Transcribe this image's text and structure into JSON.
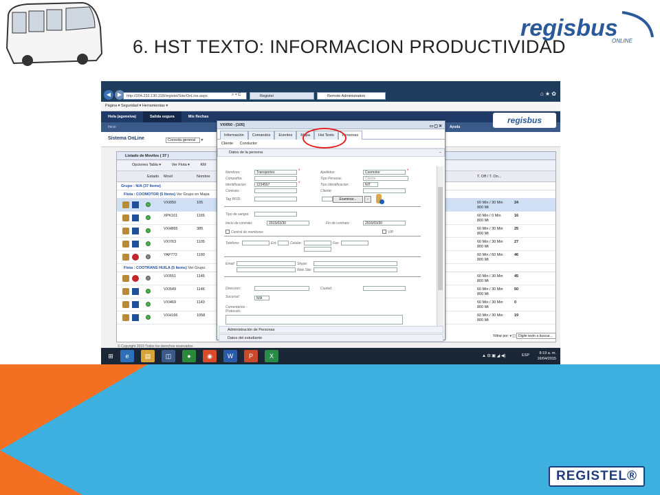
{
  "slide": {
    "title": "6. HST TEXTO: INFORMACION PRODUCTIVIDAD",
    "brand_top": "regisbus",
    "brand_top_sub": "ONLINE",
    "brand_bottom": "REGISTEL®"
  },
  "browser": {
    "address": "http://204.232.130.228/registel/Site/OnLine.aspx",
    "address_controls": "⌕ ▾ C",
    "tabs": [
      "Registel",
      "Remote Administration"
    ],
    "command_bar": "Página ▾  Seguridad ▾  Herramientas ▾",
    "window_icons": "⌂ ★ ✿"
  },
  "app": {
    "nav": [
      "Hola (agoneiva)",
      "Salida segura",
      "Mis flechas"
    ],
    "subnav": "Inicio",
    "help": "Ayuda",
    "logo": "regisbus",
    "system_name": "Sistema OnLine",
    "console_label": "Consola general"
  },
  "list": {
    "title": "Listado de Moviles ( 37 )",
    "toolbar": [
      "Opciones Tabla ▾",
      "Ver Flota ▾",
      "KM"
    ],
    "columns": [
      "Estado",
      "Movil",
      "Nombre",
      "T. Off / T. On..."
    ],
    "group_header": "Grupo : N/A (37 Items)",
    "fleets": [
      {
        "label": "Flota : COOMOTOR (5 Items)",
        "link": "Ver Grupo en Mapa",
        "rows": [
          {
            "movil": "VXI050",
            "nombre": "105",
            "t": "60 Min / 30 Min",
            "t2": "800 Mt",
            "v": "24",
            "status": "green",
            "sel": true
          },
          {
            "movil": "XPK161",
            "nombre": "1165",
            "t": "60 Min / 0 Min",
            "t2": "800 Mt",
            "v": "16",
            "status": "green"
          },
          {
            "movil": "VXH865",
            "nombre": "385",
            "t": "60 Min / 30 Min",
            "t2": "800 Mt",
            "v": "25",
            "status": "green"
          },
          {
            "movil": "VXI763",
            "nombre": "1105",
            "t": "60 Min / 30 Min",
            "t2": "800 Mt",
            "v": "27",
            "status": "green"
          },
          {
            "movil": "YAP772",
            "nombre": "1190",
            "t": "60 Min / 60 Min",
            "t2": "800 Mt",
            "v": "46",
            "status": "gray"
          }
        ]
      },
      {
        "label": "Flota : COOTRANS HUILA (5 Items)",
        "link": "Ver Grupo",
        "rows": [
          {
            "movil": "VXI551",
            "nombre": "1145",
            "t": "60 Min / 30 Min",
            "t2": "800 Mt",
            "v": "45",
            "status": "gray"
          },
          {
            "movil": "VXI549",
            "nombre": "1146",
            "t": "60 Min / 30 Min",
            "t2": "800 Mt",
            "v": "50",
            "status": "green"
          },
          {
            "movil": "VXI469",
            "nombre": "1143",
            "t": "60 Min / 30 Min",
            "t2": "800 Mt",
            "v": "0",
            "status": "green"
          },
          {
            "movil": "VXH166",
            "nombre": "1058",
            "t": "60 Min / 30 Min",
            "t2": "800 Mt",
            "v": "19",
            "status": "green"
          }
        ]
      }
    ],
    "footer": "© Copyright 2015 Todos los derechos reservados",
    "filter_label": "Filtrar por: ▾",
    "filter_brackets": "[ ]",
    "filter_placeholder": "Digite texto a buscar..."
  },
  "modal": {
    "title": "VXI050 - [105]",
    "tabs": [
      "Información",
      "Comandos",
      "Eventos",
      "Mapa",
      "Hst Texto",
      "Personas"
    ],
    "subtabs": [
      "Cliente",
      "Conductor"
    ],
    "section": "Datos de la persona",
    "fields": {
      "nombres_label": "Nombres:",
      "nombres": "Transportes",
      "apellidos_label": "Apellidos:",
      "apellidos": "Coomotor",
      "compania_label": "Compañía:",
      "tipo_persona_label": "Tipo Persona:",
      "tipo_persona": "Cliente",
      "identificacion_label": "Identificacion:",
      "identificacion": "1234567",
      "tipo_identificacion_label": "Tipo Identificacion:",
      "tipo_identificacion": "NIT",
      "contrato_label": "Contrato:",
      "cliente_label": "Cliente:",
      "tag_rfid_label": "Tag RFID:",
      "examinar": "Examinar...",
      "tipo_sangre_label": "Tipo de sangre:",
      "inicio_contrato_label": "Inicio de contrato:",
      "inicio_contrato": "2015/03/30",
      "fin_contrato_label": "Fin de contrato:",
      "fin_contrato": "2016/03/30",
      "central_label": "Central de monitoreo",
      "vip_label": "VIP",
      "telefono_label": "Telefono:",
      "ext_label": "Ext:",
      "celular_label": "Celular:",
      "fax_label": "Fax:",
      "email_label": "Email:",
      "skype_label": "Skype:",
      "website_label": "Web Site:",
      "direccion_label": "Direccion:",
      "ciudad_label": "Ciudad:",
      "sucursal_label": "Sucursal:",
      "sucursal": "N/A",
      "comentarios_label": "Comentarios -",
      "protocolo_label": "Protocolo:"
    },
    "bottom_sections": [
      "Administración de Personas",
      "Datos del estudiante"
    ]
  },
  "taskbar": {
    "time": "8:19 a. m.",
    "date": "16/04/2015",
    "lang": "ESP",
    "icons": "▲ ⊟ ▣ ◢ ◀)"
  },
  "colors": {
    "accent_blue": "#3db0e0",
    "accent_orange": "#f36f21",
    "app_nav": "#1f3a66",
    "highlight_circle": "#e02020"
  }
}
